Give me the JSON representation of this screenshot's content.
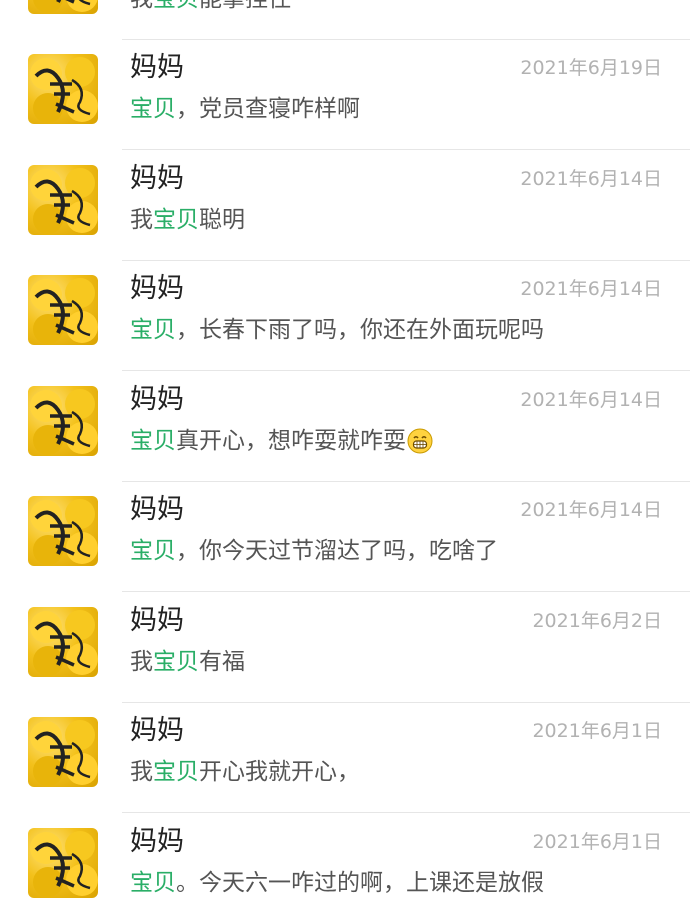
{
  "colors": {
    "highlight": "#2aae67",
    "time": "#b2b2b2",
    "name": "#222222",
    "preview": "#555555",
    "avatar": "#f3c11b"
  },
  "avatar_icon": "yellow-flower-calligraphy-avatar-icon",
  "partial_top": {
    "pre": "我",
    "hl": "宝贝",
    "post": "能拿捏住"
  },
  "messages": [
    {
      "name": "妈妈",
      "time": "2021年6月19日",
      "pre": "",
      "hl": "宝贝",
      "post": "，党员查寝咋样啊",
      "emoji": ""
    },
    {
      "name": "妈妈",
      "time": "2021年6月14日",
      "pre": "我",
      "hl": "宝贝",
      "post": "聪明",
      "emoji": ""
    },
    {
      "name": "妈妈",
      "time": "2021年6月14日",
      "pre": "",
      "hl": "宝贝",
      "post": "，长春下雨了吗，你还在外面玩呢吗",
      "emoji": ""
    },
    {
      "name": "妈妈",
      "time": "2021年6月14日",
      "pre": "",
      "hl": "宝贝",
      "post": "真开心，想咋耍就咋耍",
      "emoji": "grinning-face-icon"
    },
    {
      "name": "妈妈",
      "time": "2021年6月14日",
      "pre": "",
      "hl": "宝贝",
      "post": "，你今天过节溜达了吗，吃啥了",
      "emoji": ""
    },
    {
      "name": "妈妈",
      "time": "2021年6月2日",
      "pre": "我",
      "hl": "宝贝",
      "post": "有福",
      "emoji": ""
    },
    {
      "name": "妈妈",
      "time": "2021年6月1日",
      "pre": "我",
      "hl": "宝贝",
      "post": "开心我就开心，",
      "emoji": ""
    },
    {
      "name": "妈妈",
      "time": "2021年6月1日",
      "pre": "",
      "hl": "宝贝",
      "post": "。今天六一咋过的啊，上课还是放假",
      "emoji": ""
    }
  ]
}
